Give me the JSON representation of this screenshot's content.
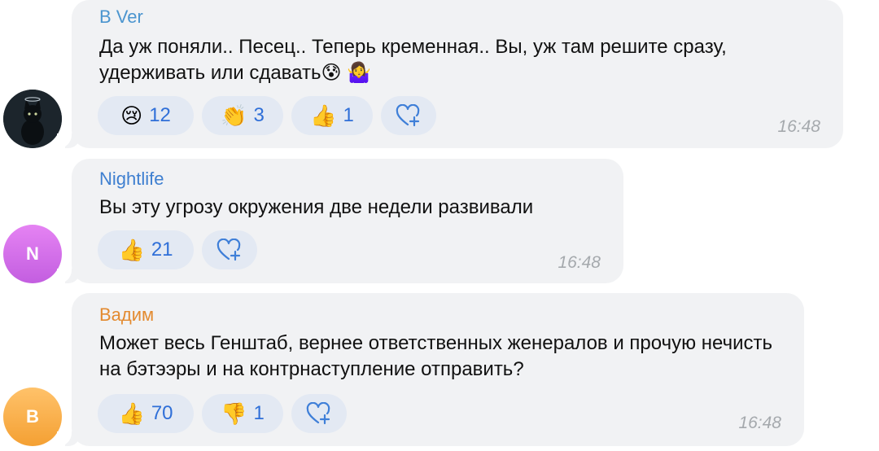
{
  "messages": [
    {
      "author": "B Ver",
      "author_color": "#4b95cf",
      "avatar": {
        "type": "image",
        "icon": "black-cat-icon"
      },
      "text": "Да уж поняли.. Песец.. Теперь кременная.. Вы, уж там решите сразу, удерживать или сдавать😰 🤷‍♀️",
      "reactions": [
        {
          "emoji": "😢",
          "count": "12",
          "icon": "crying-face-icon"
        },
        {
          "emoji": "👏",
          "count": "3",
          "icon": "clapping-hands-icon"
        },
        {
          "emoji": "👍",
          "count": "1",
          "icon": "thumbs-up-icon"
        }
      ],
      "time": "16:48"
    },
    {
      "author": "Nightlife",
      "author_color": "#3e7fd0",
      "avatar": {
        "type": "letter",
        "letter": "N"
      },
      "text": "Вы эту угрозу окружения две недели развивали",
      "reactions": [
        {
          "emoji": "👍",
          "count": "21",
          "icon": "thumbs-up-icon"
        }
      ],
      "time": "16:48"
    },
    {
      "author": "Вадим",
      "author_color": "#e38a2f",
      "avatar": {
        "type": "letter",
        "letter": "B"
      },
      "text": "Может весь Генштаб, вернее ответственных женералов и прочую нечисть на бэтээры и на контрнаступление отправить?",
      "reactions": [
        {
          "emoji": "👍",
          "count": "70",
          "icon": "thumbs-up-icon"
        },
        {
          "emoji": "👎",
          "count": "1",
          "icon": "thumbs-down-icon"
        }
      ],
      "time": "16:48"
    }
  ]
}
